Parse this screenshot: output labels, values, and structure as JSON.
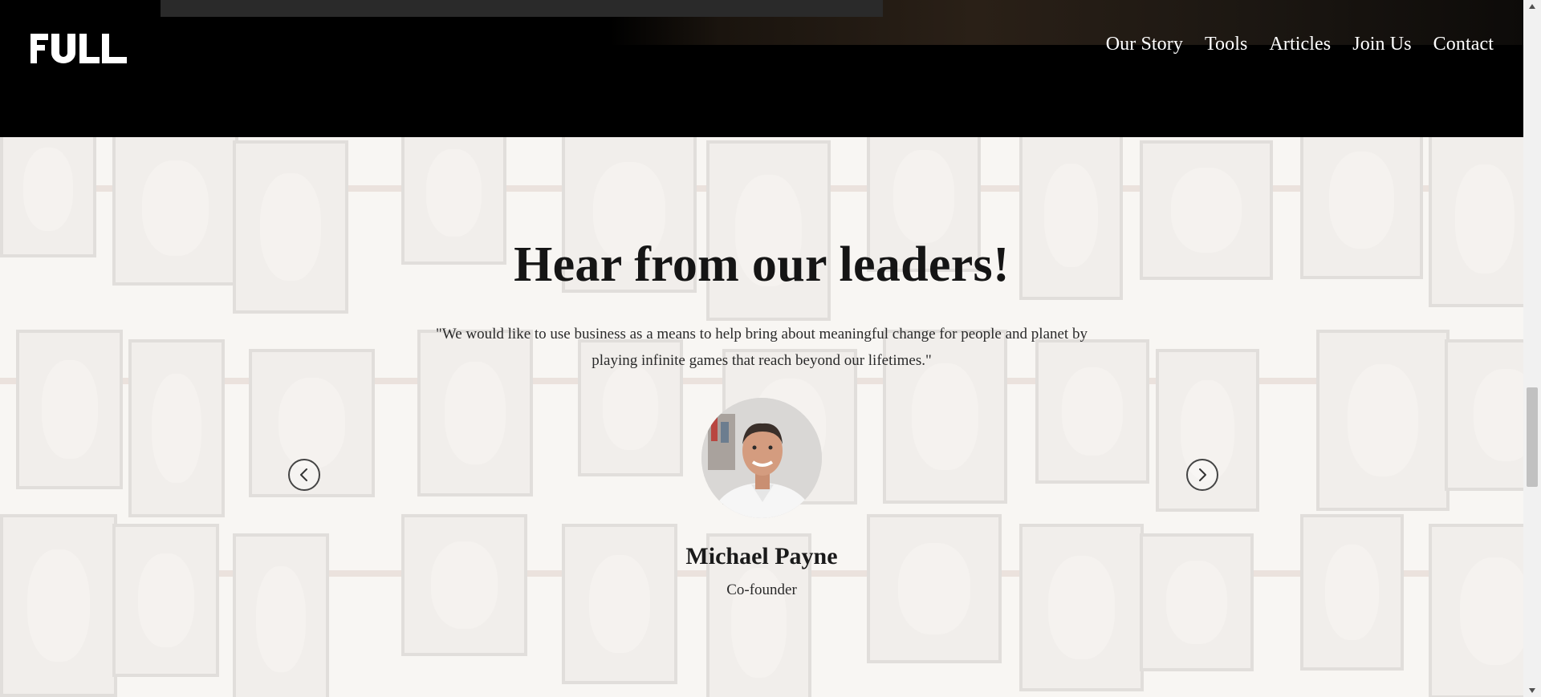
{
  "header": {
    "logo": {
      "text": "FULL"
    },
    "nav": [
      {
        "label": "Our Story"
      },
      {
        "label": "Tools"
      },
      {
        "label": "Articles"
      },
      {
        "label": "Join Us"
      },
      {
        "label": "Contact"
      }
    ]
  },
  "leaders": {
    "title": "Hear from our leaders!",
    "quote": "\"We would like to use business as a means to help bring about meaningful change for people and planet by playing infinite games that reach beyond our lifetimes.\"",
    "person": {
      "name": "Michael Payne",
      "role": "Co-founder"
    },
    "prev_icon": "chevron-left-icon",
    "next_icon": "chevron-right-icon"
  }
}
